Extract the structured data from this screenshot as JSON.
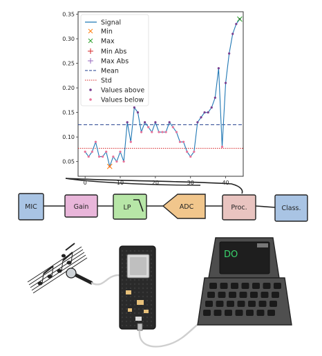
{
  "chart_data": {
    "type": "line",
    "xlim": [
      -2,
      45
    ],
    "ylim": [
      0.02,
      0.355
    ],
    "x_ticks": [
      0,
      10,
      20,
      30,
      40
    ],
    "y_ticks": [
      0.05,
      0.1,
      0.15,
      0.2,
      0.25,
      0.3,
      0.35
    ],
    "x_tick_labels": [
      "0",
      "10",
      "20",
      "30",
      "40"
    ],
    "y_tick_labels": [
      "0.05",
      "0.10",
      "0.15",
      "0.20",
      "0.25",
      "0.30",
      "0.35"
    ],
    "x": [
      0,
      1,
      2,
      3,
      4,
      5,
      6,
      7,
      8,
      9,
      10,
      11,
      12,
      13,
      14,
      15,
      16,
      17,
      18,
      19,
      20,
      21,
      22,
      23,
      24,
      25,
      26,
      27,
      28,
      29,
      30,
      31,
      32,
      33,
      34,
      35,
      36,
      37,
      38,
      39,
      40,
      41,
      42,
      43,
      44
    ],
    "series": [
      {
        "name": "Signal",
        "color": "#1f77b4",
        "values": [
          0.07,
          0.06,
          0.07,
          0.09,
          0.06,
          0.06,
          0.07,
          0.04,
          0.06,
          0.05,
          0.07,
          0.05,
          0.13,
          0.09,
          0.16,
          0.15,
          0.11,
          0.13,
          0.12,
          0.11,
          0.13,
          0.11,
          0.11,
          0.11,
          0.13,
          0.12,
          0.11,
          0.09,
          0.09,
          0.07,
          0.06,
          0.07,
          0.13,
          0.14,
          0.15,
          0.15,
          0.16,
          0.18,
          0.24,
          0.08,
          0.21,
          0.27,
          0.31,
          0.33,
          0.34
        ]
      }
    ],
    "min": {
      "label": "Min",
      "x": 7,
      "y": 0.04,
      "color": "#ff7f0e"
    },
    "max": {
      "label": "Max",
      "x": 44,
      "y": 0.34,
      "color": "#2ca02c"
    },
    "min_abs": {
      "label": "Min Abs",
      "color": "#d62728"
    },
    "max_abs": {
      "label": "Max Abs",
      "color": "#9467bd"
    },
    "mean": {
      "label": "Mean",
      "value": 0.125,
      "color": "#1f3d8c"
    },
    "std": {
      "label": "Std",
      "value": 0.077,
      "color": "#d62728"
    },
    "values_above": {
      "label": "Values above",
      "color": "#7b3f8f"
    },
    "values_below": {
      "label": "Values below",
      "color": "#e8739a"
    }
  },
  "pipeline": {
    "blocks": [
      {
        "id": "mic",
        "label": "MIC",
        "color": "#a9c4e4"
      },
      {
        "id": "gain",
        "label": "Gain",
        "color": "#e9b6da"
      },
      {
        "id": "lp",
        "label": "LP",
        "color": "#b7e6a7"
      },
      {
        "id": "adc",
        "label": "ADC",
        "color": "#f1c68c"
      },
      {
        "id": "proc",
        "label": "Proc.",
        "color": "#e9c4c0"
      },
      {
        "id": "class",
        "label": "Class.",
        "color": "#a9c4e4"
      }
    ]
  },
  "laptop": {
    "screen_text": "DO",
    "screen_text_color": "#39d46b"
  }
}
